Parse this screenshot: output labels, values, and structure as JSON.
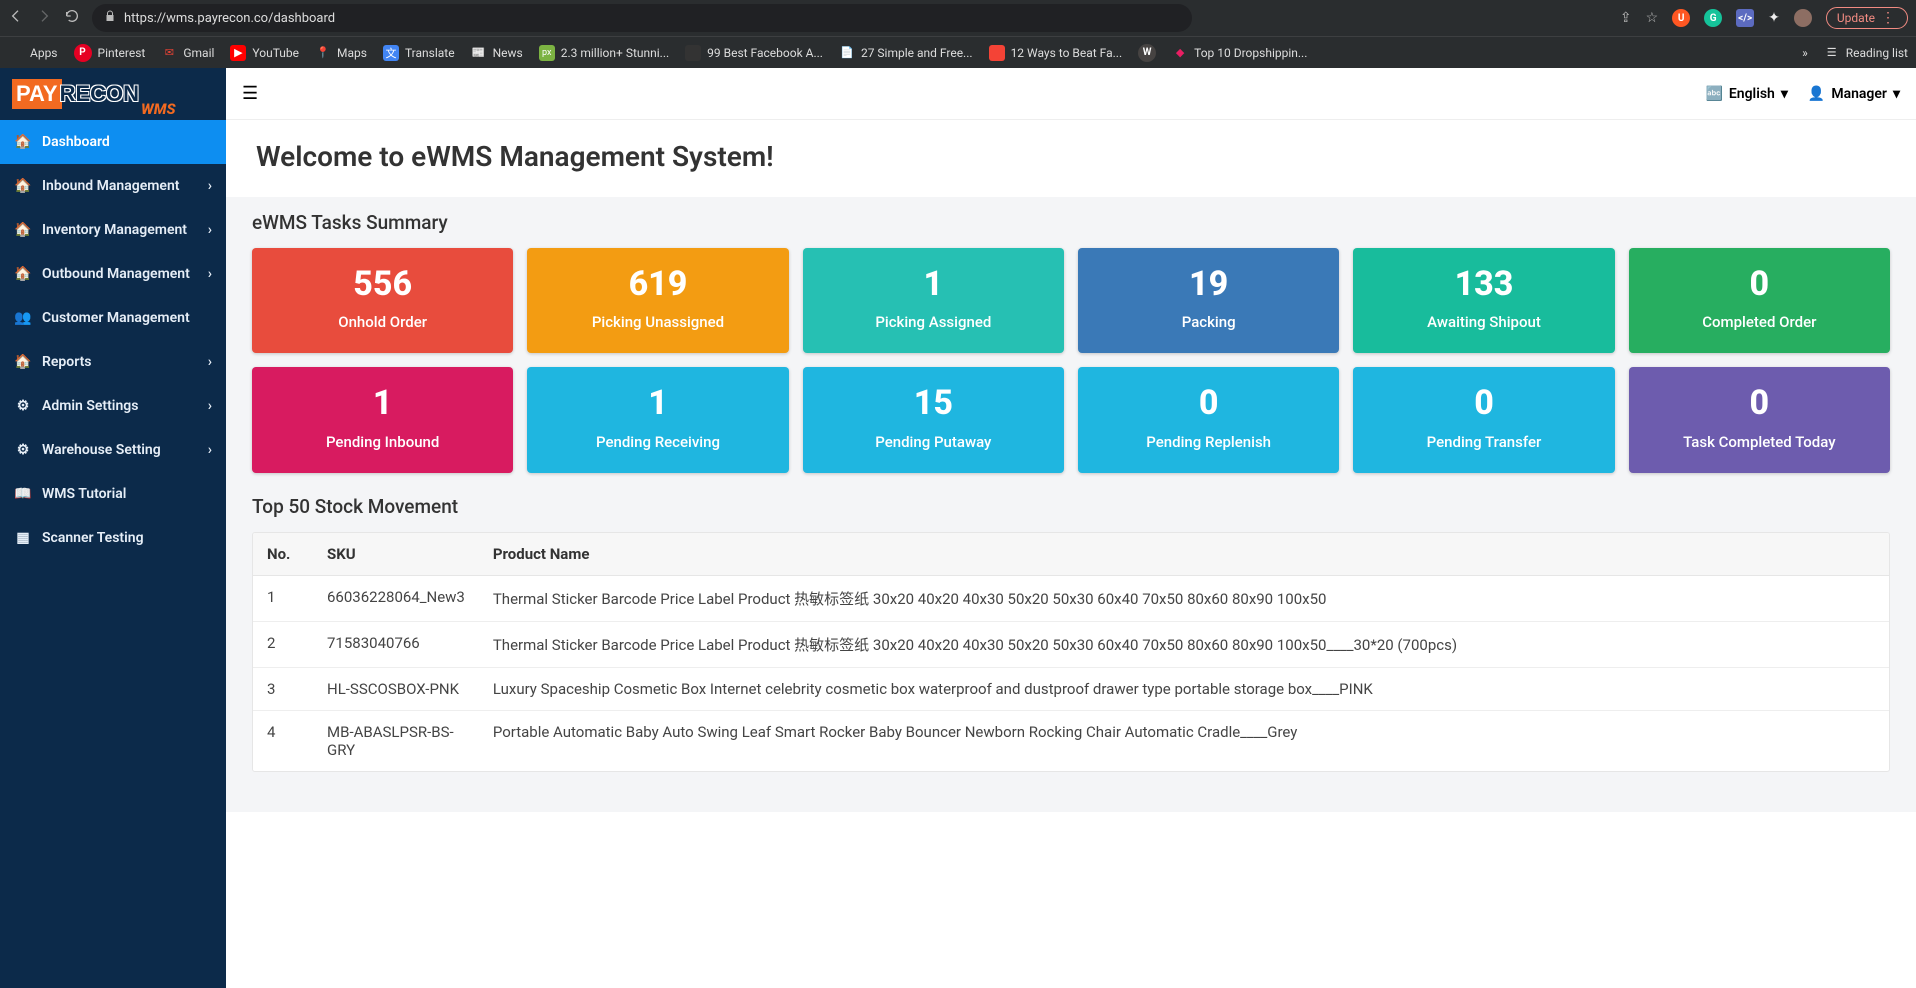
{
  "browser": {
    "url": "https://wms.payrecon.co/dashboard",
    "update_label": "Update",
    "bookmarks": [
      {
        "label": "Apps",
        "color": "#fff"
      },
      {
        "label": "Pinterest",
        "color": "#e60023"
      },
      {
        "label": "Gmail",
        "color": "#ea4335"
      },
      {
        "label": "YouTube",
        "color": "#ff0000"
      },
      {
        "label": "Maps",
        "color": "#34a853"
      },
      {
        "label": "Translate",
        "color": "#4285f4"
      },
      {
        "label": "News",
        "color": "#4285f4"
      },
      {
        "label": "2.3 million+ Stunni...",
        "color": "#7cb342"
      },
      {
        "label": "99 Best Facebook A...",
        "color": "#555"
      },
      {
        "label": "27 Simple and Free...",
        "color": "#888"
      },
      {
        "label": "12 Ways to Beat Fa...",
        "color": "#f44336"
      },
      {
        "label": "",
        "color": "#464342"
      },
      {
        "label": "Top 10 Dropshippin...",
        "color": "#e91e63"
      }
    ],
    "reading_list": "Reading list"
  },
  "logo": {
    "part1": "PAY",
    "part2": "RECON",
    "suffix": "WMS"
  },
  "sidebar": [
    {
      "label": "Dashboard",
      "icon": "dashboard",
      "chev": false,
      "active": true
    },
    {
      "label": "Inbound Management",
      "icon": "dashboard",
      "chev": true
    },
    {
      "label": "Inventory Management",
      "icon": "dashboard",
      "chev": true
    },
    {
      "label": "Outbound Management",
      "icon": "dashboard",
      "chev": true
    },
    {
      "label": "Customer Management",
      "icon": "users",
      "chev": false
    },
    {
      "label": "Reports",
      "icon": "dashboard",
      "chev": true
    },
    {
      "label": "Admin Settings",
      "icon": "gear",
      "chev": true
    },
    {
      "label": "Warehouse Setting",
      "icon": "gear",
      "chev": true
    },
    {
      "label": "WMS Tutorial",
      "icon": "book",
      "chev": false
    },
    {
      "label": "Scanner Testing",
      "icon": "qr",
      "chev": false
    }
  ],
  "topbar": {
    "lang": "English",
    "user": "Manager"
  },
  "welcome_title": "Welcome to eWMS Management System!",
  "summary_title": "eWMS Tasks Summary",
  "summary_cards": [
    {
      "value": "556",
      "label": "Onhold Order",
      "color": "#e84c3d"
    },
    {
      "value": "619",
      "label": "Picking Unassigned",
      "color": "#f39c12"
    },
    {
      "value": "1",
      "label": "Picking Assigned",
      "color": "#26c0b3"
    },
    {
      "value": "19",
      "label": "Packing",
      "color": "#3a79b7"
    },
    {
      "value": "133",
      "label": "Awaiting Shipout",
      "color": "#18bc9c"
    },
    {
      "value": "0",
      "label": "Completed Order",
      "color": "#27ae60"
    },
    {
      "value": "1",
      "label": "Pending Inbound",
      "color": "#d81b60"
    },
    {
      "value": "1",
      "label": "Pending Receiving",
      "color": "#1fb6e0"
    },
    {
      "value": "15",
      "label": "Pending Putaway",
      "color": "#1fb6e0"
    },
    {
      "value": "0",
      "label": "Pending Replenish",
      "color": "#1fb6e0"
    },
    {
      "value": "0",
      "label": "Pending Transfer",
      "color": "#1fb6e0"
    },
    {
      "value": "0",
      "label": "Task Completed Today",
      "color": "#6d5cae"
    }
  ],
  "stock_title": "Top 50 Stock Movement",
  "stock_headers": [
    "No.",
    "SKU",
    "Product Name"
  ],
  "stock_rows": [
    {
      "no": "1",
      "sku": "66036228064_New3",
      "name": "Thermal Sticker Barcode Price Label Product 热敏标签纸 30x20 40x20 40x30 50x20 50x30 60x40 70x50 80x60 80x90 100x50"
    },
    {
      "no": "2",
      "sku": "71583040766",
      "name": "Thermal Sticker Barcode Price Label Product 热敏标签纸 30x20 40x20 40x30 50x20 50x30 60x40 70x50 80x60 80x90 100x50____30*20 (700pcs)"
    },
    {
      "no": "3",
      "sku": "HL-SSCOSBOX-PNK",
      "name": "Luxury Spaceship Cosmetic Box Internet celebrity cosmetic box waterproof and dustproof drawer type portable storage box____PINK"
    },
    {
      "no": "4",
      "sku": "MB-ABASLPSR-BS-GRY",
      "name": "Portable Automatic Baby Auto Swing Leaf Smart Rocker Baby Bouncer Newborn Rocking Chair Automatic Cradle____Grey"
    }
  ]
}
